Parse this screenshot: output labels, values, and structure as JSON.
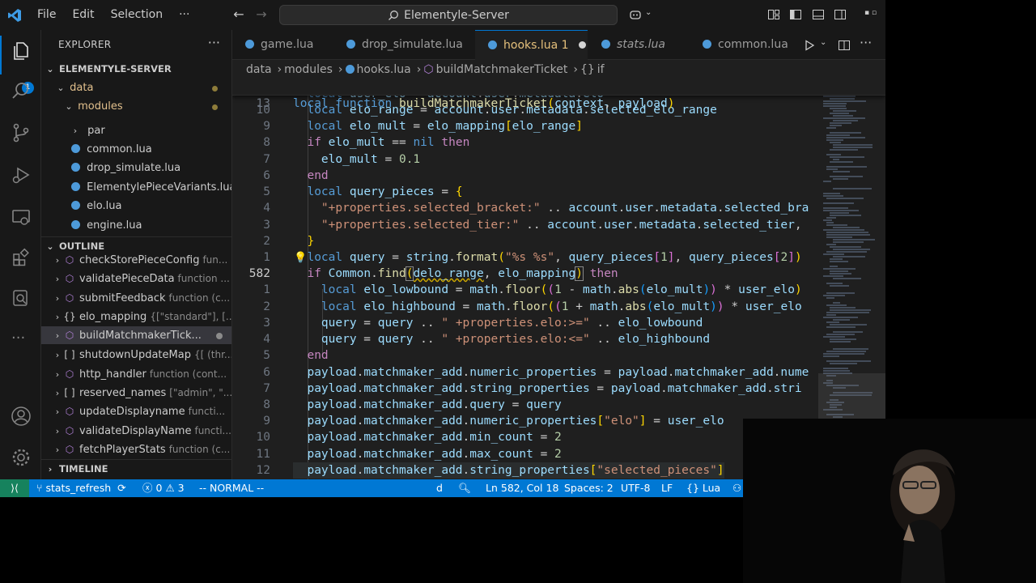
{
  "titlebar": {
    "menu": [
      "File",
      "Edit",
      "Selection",
      "···"
    ],
    "search": "Elementyle-Server"
  },
  "activity": {
    "explorer_badge": "1"
  },
  "sidebar": {
    "title": "EXPLORER",
    "more": "···",
    "root": "ELEMENTYLE-SERVER",
    "folders": [
      {
        "label": "data"
      },
      {
        "label": "modules"
      }
    ],
    "files": [
      {
        "label": "par",
        "type": "folder"
      },
      {
        "label": "common.lua",
        "type": "lua"
      },
      {
        "label": "drop_simulate.lua",
        "type": "lua"
      },
      {
        "label": "ElementylePieceVariants.lua",
        "type": "lua"
      },
      {
        "label": "elo.lua",
        "type": "lua"
      },
      {
        "label": "engine.lua",
        "type": "lua"
      }
    ],
    "outline_title": "OUTLINE",
    "outline": [
      {
        "icon": "function-icon",
        "label": "checkStorePieceConfig",
        "detail": "fun..."
      },
      {
        "icon": "function-icon",
        "label": "validatePieceData",
        "detail": "function ..."
      },
      {
        "icon": "function-icon",
        "label": "submitFeedback",
        "detail": "function (c..."
      },
      {
        "icon": "object-icon",
        "label": "elo_mapping",
        "detail": "{[\"standard\"], [..."
      },
      {
        "icon": "function-icon",
        "label": "buildMatchmakerTick...",
        "detail": ""
      },
      {
        "icon": "array-icon",
        "label": "shutdownUpdateMap",
        "detail": "{[ (thr..."
      },
      {
        "icon": "function-icon",
        "label": "http_handler",
        "detail": "function (cont..."
      },
      {
        "icon": "array-icon",
        "label": "reserved_names",
        "detail": "[\"admin\", \"..."
      },
      {
        "icon": "function-icon",
        "label": "updateDisplayname",
        "detail": "functi..."
      },
      {
        "icon": "function-icon",
        "label": "validateDisplayName",
        "detail": "functi..."
      },
      {
        "icon": "function-icon",
        "label": "fetchPlayerStats",
        "detail": "function (c..."
      }
    ],
    "timeline_title": "TIMELINE"
  },
  "tabs": [
    {
      "label": "game.lua",
      "active": false
    },
    {
      "label": "drop_simulate.lua",
      "active": false
    },
    {
      "label": "hooks.lua 1",
      "active": true
    },
    {
      "label": "stats.lua",
      "active": false
    },
    {
      "label": "common.lua",
      "active": false
    }
  ],
  "breadcrumb": {
    "parts": [
      "data",
      "modules",
      "hooks.lua",
      "buildMatchmakerTicket",
      "if"
    ]
  },
  "editor": {
    "sticky_line_number": "13",
    "current_line_number": "582",
    "line_numbers": [
      "10",
      "9",
      "8",
      "7",
      "6",
      "5",
      "4",
      "3",
      "2",
      "1",
      "582",
      "1",
      "2",
      "3",
      "4",
      "5",
      "6",
      "7",
      "8",
      "9",
      "10",
      "11",
      "12"
    ]
  },
  "status": {
    "branch": "stats_refresh",
    "errors": "0",
    "warnings": "3",
    "mode": "-- NORMAL --",
    "pending": "d",
    "position": "Ln 582, Col 18",
    "spaces": "Spaces: 2",
    "encoding": "UTF-8",
    "eol": "LF",
    "language": "Lua"
  },
  "colors": {
    "accent": "#0078d4",
    "statusbar": "#0078d4",
    "keyword": "#569cd6",
    "string": "#ce9178",
    "function": "#dcdcaa",
    "variable": "#9cdcfe"
  }
}
